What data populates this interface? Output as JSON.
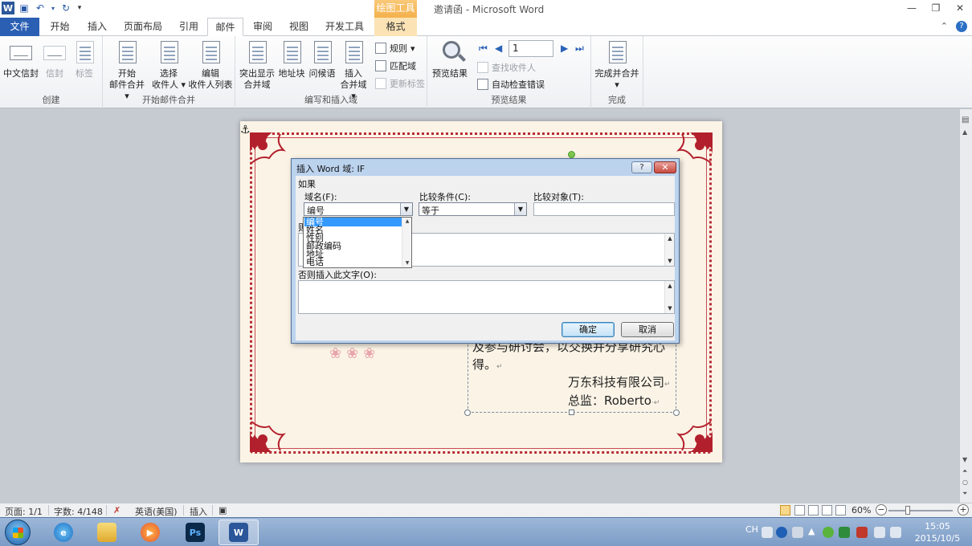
{
  "window": {
    "title": "邀请函 - Microsoft Word",
    "context_tab_group": "绘图工具"
  },
  "tabs": [
    {
      "label": "文件",
      "kind": "file"
    },
    {
      "label": "开始"
    },
    {
      "label": "插入"
    },
    {
      "label": "页面布局"
    },
    {
      "label": "引用"
    },
    {
      "label": "邮件",
      "kind": "active"
    },
    {
      "label": "审阅"
    },
    {
      "label": "视图"
    },
    {
      "label": "开发工具"
    },
    {
      "label": "格式",
      "kind": "ctx"
    }
  ],
  "ribbon": {
    "groups": {
      "create": "创建",
      "start_merge": "开始邮件合并",
      "write_insert": "编写和插入域",
      "preview": "预览结果",
      "finish": "完成"
    },
    "buttons": {
      "chinese_envelope": "中文信封",
      "envelope": "信封",
      "label": "标签",
      "start_merge_1": "开始",
      "start_merge_2": "邮件合并",
      "select_recipients_1": "选择",
      "select_recipients_2": "收件人",
      "edit_list_1": "编辑",
      "edit_list_2": "收件人列表",
      "highlight_1": "突出显示",
      "highlight_2": "合并域",
      "address_block": "地址块",
      "greeting": "问候语",
      "insert_field_1": "插入",
      "insert_field_2": "合并域",
      "rules": "规则",
      "match_fields": "匹配域",
      "update_labels": "更新标签",
      "preview_results": "预览结果",
      "record_number": "1",
      "find_recipient": "查找收件人",
      "auto_check": "自动检查错误",
      "finish_merge": "完成并合并"
    }
  },
  "document": {
    "partial_text": "及参与研讨会，以交换并分享研究心",
    "line2": "得。",
    "company": "万东科技有限公司",
    "director": "总监：Roberto"
  },
  "dialog": {
    "title": "插入 Word 域: IF",
    "help": "?",
    "close": "✕",
    "if_label": "如果",
    "field_name_label": "域名(F):",
    "field_name_value": "编号",
    "compare_label": "比较条件(C):",
    "compare_value": "等于",
    "compare_to_label": "比较对象(T):",
    "compare_to_value": "",
    "then_label_partial": "则",
    "else_label": "否则插入此文字(O):",
    "ok": "确定",
    "cancel": "取消"
  },
  "dropdown": {
    "items": [
      "编号",
      "姓名",
      "性别",
      "邮政编码",
      "地址",
      "电话"
    ],
    "selected_index": 0
  },
  "statusbar": {
    "page": "页面: 1/1",
    "words": "字数: 4/148",
    "language": "英语(美国)",
    "mode": "插入",
    "zoom": "60%"
  },
  "taskbar": {
    "tray_lang": "CH",
    "time": "15:05",
    "date": "2015/10/5"
  },
  "colors": {
    "file_tab": "#2b5fb4",
    "context_orange": "#f4b04b",
    "border_red": "#b72a36",
    "selection_blue": "#3399ff"
  }
}
